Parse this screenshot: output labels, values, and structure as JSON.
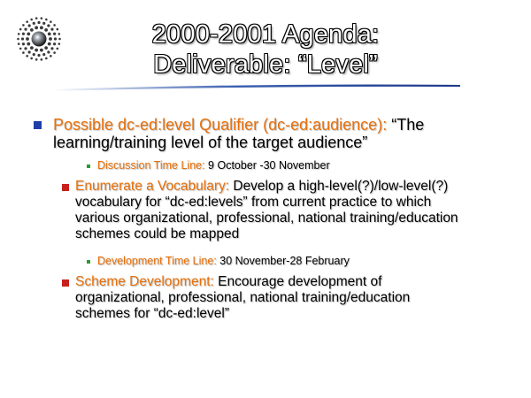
{
  "slide": {
    "title_line1": "2000-2001 Agenda:",
    "title_line2": "Deliverable: “Level”"
  },
  "colors": {
    "accent_orange": "#e8700a",
    "bullet_blue": "#1f3fa8",
    "bullet_red": "#c8201e",
    "bullet_green": "#2e9a2e",
    "swoosh_blue": "#3a5fb0"
  },
  "logo": {
    "icon": "dotted-circle-logo"
  },
  "bullets": [
    {
      "label": "Possible dc-ed:level Qualifier (dc-ed:audience):",
      "text_line1": " “The",
      "text_line2": "learning/training level of the target audience”"
    },
    {
      "label": "Discussion Time Line:",
      "text": " 9 October -30 November"
    },
    {
      "label": "Enumerate a Vocabulary:",
      "text_line1": " Develop a high-level(?)/low-level(?)",
      "text_line2": "vocabulary for “dc-ed:levels” from current practice to which",
      "text_line3": "various organizational, professional, national training/education",
      "text_line4": "schemes could be mapped"
    },
    {
      "label": "Development Time Line:",
      "text": " 30 November-28 February"
    },
    {
      "label": "Scheme Development:",
      "text_line1": " Encourage development of",
      "text_line2": "organizational, professional, national training/education",
      "text_line3": "schemes for “dc-ed:level”"
    }
  ]
}
